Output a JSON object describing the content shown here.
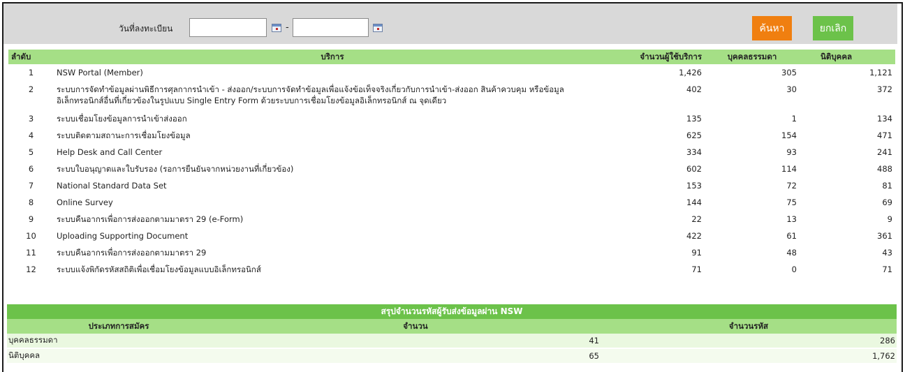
{
  "search": {
    "date_label": "วันที่ลงทะเบียน",
    "date_from_value": "",
    "date_to_value": "",
    "separator": "-",
    "search_button": "ค้นหา",
    "cancel_button": "ยกเลิก"
  },
  "services_table": {
    "headers": {
      "no": "ลำดับ",
      "service": "บริการ",
      "users": "จำนวนผู้ใช้บริการ",
      "person": "บุคคลธรรมดา",
      "juristic": "นิติบุคคล"
    },
    "rows": [
      {
        "no": "1",
        "service": "NSW Portal (Member)",
        "users": "1,426",
        "person": "305",
        "juristic": "1,121"
      },
      {
        "no": "2",
        "service": "ระบบการจัดทำข้อมูลผ่านพิธีการศุลกากรนำเข้า - ส่งออก/ระบบการจัดทำข้อมูลเพื่อแจ้งข้อเท็จจริงเกี่ยวกับการนำเข้า-ส่งออก สินค้าควบคุม หรือข้อมูล",
        "service_line2": "อิเล็กทรอนิกส์อื่นที่เกี่ยวข้องในรูปแบบ Single Entry Form ด้วยระบบการเชื่อมโยงข้อมูลอิเล็กทรอนิกส์ ณ จุดเดียว",
        "users": "402",
        "person": "30",
        "juristic": "372"
      },
      {
        "no": "3",
        "service": "ระบบเชื่อมโยงข้อมูลการนำเข้าส่งออก",
        "users": "135",
        "person": "1",
        "juristic": "134"
      },
      {
        "no": "4",
        "service": "ระบบติดตามสถานะการเชื่อมโยงข้อมูล",
        "users": "625",
        "person": "154",
        "juristic": "471"
      },
      {
        "no": "5",
        "service": "Help Desk and Call Center",
        "users": "334",
        "person": "93",
        "juristic": "241"
      },
      {
        "no": "6",
        "service": "ระบบใบอนุญาตและใบรับรอง (รอการยืนยันจากหน่วยงานที่เกี่ยวข้อง)",
        "users": "602",
        "person": "114",
        "juristic": "488"
      },
      {
        "no": "7",
        "service": "National Standard Data Set",
        "users": "153",
        "person": "72",
        "juristic": "81"
      },
      {
        "no": "8",
        "service": "Online Survey",
        "users": "144",
        "person": "75",
        "juristic": "69"
      },
      {
        "no": "9",
        "service": "ระบบคืนอากรเพื่อการส่งออกตามมาตรา 29 (e-Form)",
        "users": "22",
        "person": "13",
        "juristic": "9"
      },
      {
        "no": "10",
        "service": "Uploading Supporting Document",
        "users": "422",
        "person": "61",
        "juristic": "361"
      },
      {
        "no": "11",
        "service": "ระบบคืนอากรเพื่อการส่งออกตามมาตรา 29",
        "users": "91",
        "person": "48",
        "juristic": "43"
      },
      {
        "no": "12",
        "service": "ระบบแจ้งพิกัดรหัสสถิติเพื่อเชื่อมโยงข้อมูลแบบอิเล็กทรอนิกส์",
        "users": "71",
        "person": "0",
        "juristic": "71"
      }
    ]
  },
  "summary_table": {
    "title": "สรุปจำนวนรหัสผู้รับส่งข้อมูลผ่าน NSW",
    "headers": {
      "type": "ประเภทการสมัคร",
      "count": "จำนวน",
      "codes": "จำนวนรหัส"
    },
    "rows": [
      {
        "type": "บุคคลธรรมดา",
        "count": "41",
        "codes": "286"
      },
      {
        "type": "นิติบุคคล",
        "count": "65",
        "codes": "1,762"
      }
    ]
  },
  "colors": {
    "header_green": "#a5df86",
    "title_green": "#6cc24a",
    "search_orange": "#f07f10",
    "toolbar_gray": "#d9d9d9"
  }
}
